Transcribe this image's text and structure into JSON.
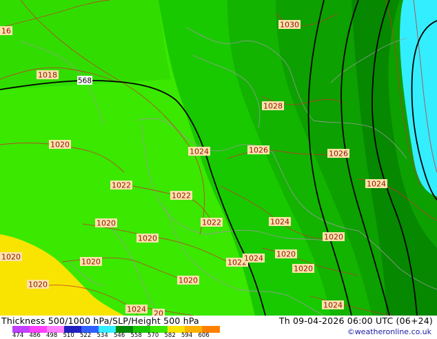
{
  "map": {
    "contour_568_label": "568",
    "pressure_labels": [
      "16",
      "1030",
      "1018",
      "1028",
      "1020",
      "1024",
      "1026",
      "1026",
      "1022",
      "1024",
      "1022",
      "1020",
      "1022",
      "1024",
      "1020",
      "1020",
      "1020",
      "1022",
      "1024",
      "1020",
      "1020",
      "1020",
      "1020",
      "1024",
      "20",
      "1020",
      "1024"
    ],
    "colors": {
      "light_green": "#3ae800",
      "mid_green": "#19c900",
      "dark_green": "#0ca000",
      "darker_green": "#068800",
      "yellow": "#f8e400",
      "cyan": "#33eeff",
      "contour_thickness": "#000000",
      "contour_pressure": "#c83232",
      "borders": "#9a9a9a"
    }
  },
  "footer": {
    "title": "Thickness 500/1000 hPa/SLP/Height 500 hPa",
    "valid_time": "Th 09-04-2026 06:00 UTC (06+24)",
    "credit": "©weatheronline.co.uk",
    "legend_ticks": [
      "474",
      "486",
      "498",
      "510",
      "522",
      "534",
      "546",
      "558",
      "570",
      "582",
      "594",
      "606"
    ],
    "legend_colors": [
      "#c040ff",
      "#ff40ff",
      "#ff80ff",
      "#2020c0",
      "#3060ff",
      "#33eeff",
      "#008800",
      "#19c900",
      "#3ae800",
      "#f8e400",
      "#ffb000",
      "#ff8000"
    ]
  }
}
